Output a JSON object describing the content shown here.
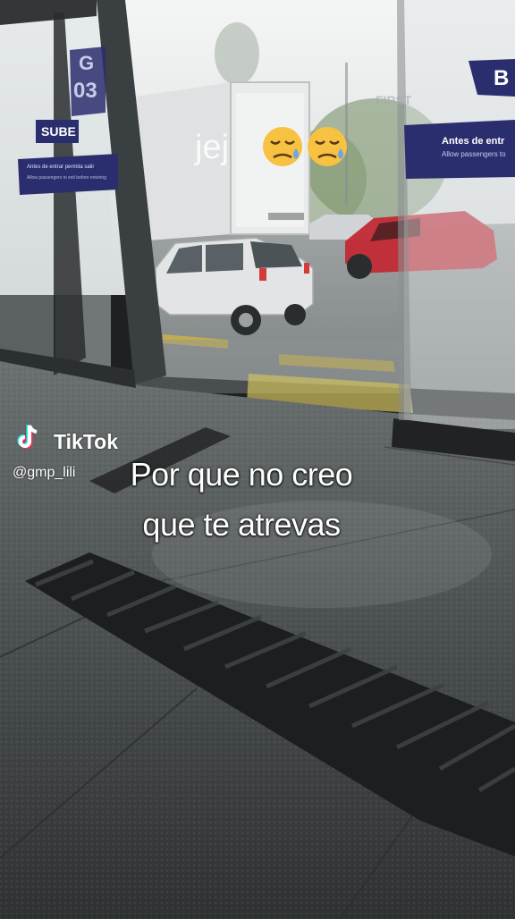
{
  "overlay": {
    "jej_text": "jej",
    "emojis": [
      "sleepy-face-emoji",
      "sleepy-face-emoji"
    ],
    "caption_line1": "Por que no creo",
    "caption_line2": "que te atrevas"
  },
  "watermark": {
    "brand": "TikTok",
    "handle": "@gmp_lili"
  },
  "signage": {
    "stop_code_letter": "G",
    "stop_code_number": "03",
    "sube_label": "SUBE",
    "left_notice_line1": "Antes de entrar permita salir",
    "left_notice_line2": "Allow passengers to exit before entering",
    "right_sign_letters": "B",
    "right_notice_line1": "Antes de entr",
    "right_notice_line2": "Allow passengers to",
    "billboard": "FIRST"
  },
  "colors": {
    "sign_navy": "#2b2e6e",
    "car_white": "#e6e8ea",
    "car_red": "#c22a35",
    "rain_sky": "#eef0f1",
    "floor": "#3a3d3e"
  }
}
